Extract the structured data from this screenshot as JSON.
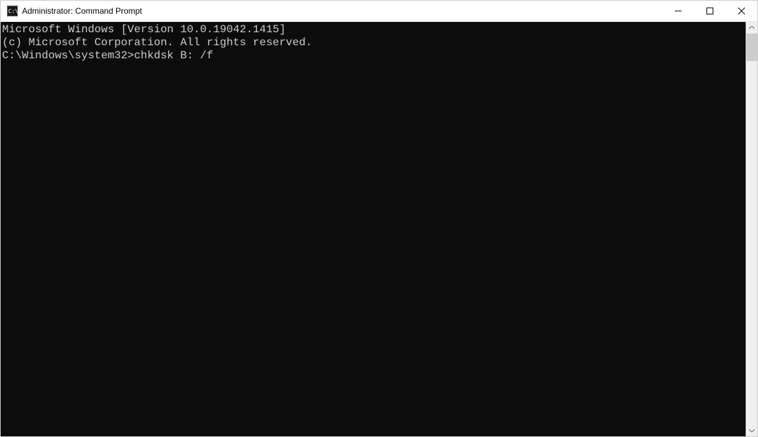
{
  "window": {
    "title": "Administrator: Command Prompt"
  },
  "terminal": {
    "line1": "Microsoft Windows [Version 10.0.19042.1415]",
    "line2": "(c) Microsoft Corporation. All rights reserved.",
    "blank1": "",
    "prompt": "C:\\Windows\\system32>",
    "command": "chkdsk B: /f"
  },
  "icons": {
    "app": "cmd-icon",
    "minimize": "minimize-icon",
    "maximize": "maximize-icon",
    "close": "close-icon",
    "scroll_up": "scroll-up-icon",
    "scroll_down": "scroll-down-icon"
  }
}
